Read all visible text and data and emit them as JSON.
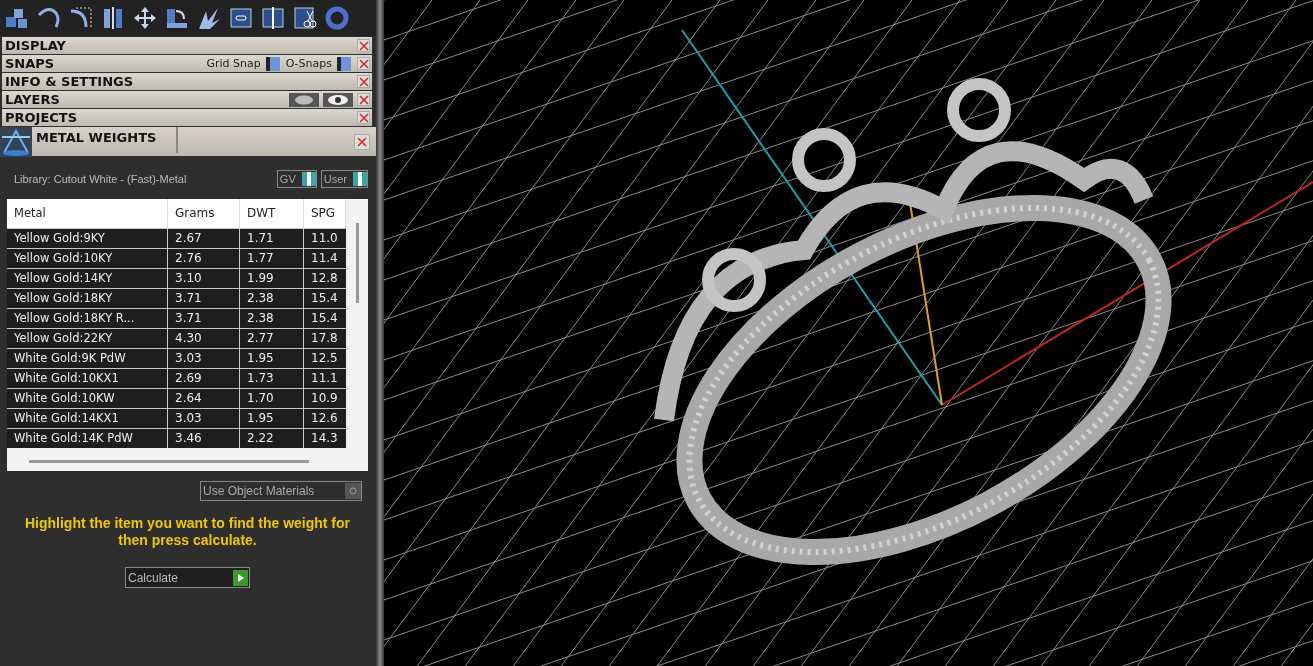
{
  "sections": [
    {
      "title": "DISPLAY",
      "kind": "plain"
    },
    {
      "title": "SNAPS",
      "kind": "snaps",
      "toggles": [
        {
          "label": "Grid Snap",
          "on": true
        },
        {
          "label": "O-Snaps",
          "on": true
        }
      ]
    },
    {
      "title": "INFO & SETTINGS",
      "kind": "plain"
    },
    {
      "title": "LAYERS",
      "kind": "layers"
    },
    {
      "title": "PROJECTS",
      "kind": "plain"
    }
  ],
  "metal_weights": {
    "title": "METAL WEIGHTS",
    "library": "Library: Cutout White - (Fast)-Metal",
    "toggles": [
      {
        "label": "GV",
        "on": true
      },
      {
        "label": "User",
        "on": true
      }
    ],
    "table": {
      "columns": [
        "Metal",
        "Grams",
        "DWT",
        "SPG"
      ],
      "rows": [
        [
          "Yellow Gold:9KY",
          "2.67",
          "1.71",
          "11.0"
        ],
        [
          "Yellow Gold:10KY",
          "2.76",
          "1.77",
          "11.4"
        ],
        [
          "Yellow Gold:14KY",
          "3.10",
          "1.99",
          "12.8"
        ],
        [
          "Yellow Gold:18KY",
          "3.71",
          "2.38",
          "15.4"
        ],
        [
          "Yellow Gold:18KY R...",
          "3.71",
          "2.38",
          "15.4"
        ],
        [
          "Yellow Gold:22KY",
          "4.30",
          "2.77",
          "17.8"
        ],
        [
          "White Gold:9K PdW",
          "3.03",
          "1.95",
          "12.5"
        ],
        [
          "White Gold:10KX1",
          "2.69",
          "1.73",
          "11.1"
        ],
        [
          "White Gold:10KW",
          "2.64",
          "1.70",
          "10.9"
        ],
        [
          "White Gold:14KX1",
          "3.03",
          "1.95",
          "12.6"
        ],
        [
          "White Gold:14K PdW",
          "3.46",
          "2.22",
          "14.3"
        ]
      ]
    },
    "use_object_materials": {
      "label": "Use Object Materials",
      "on": false
    },
    "hint": "Highlight the item you want to find the weight for then press calculate.",
    "calculate": "Calculate"
  }
}
